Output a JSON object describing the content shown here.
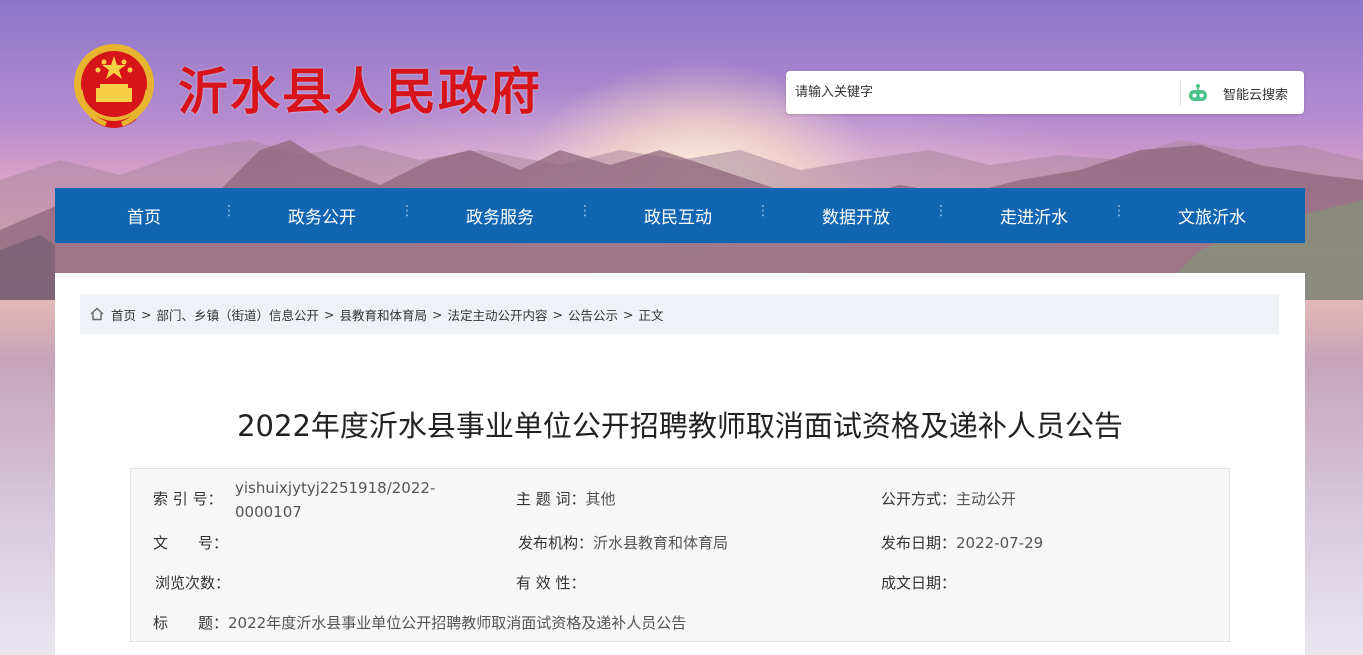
{
  "header": {
    "site_title": "沂水县人民政府",
    "emblem": "national-emblem-icon",
    "search": {
      "placeholder": "请输入关键字",
      "button_label": "智能云搜索",
      "button_icon": "robot-icon"
    }
  },
  "nav": {
    "items": [
      "首页",
      "政务公开",
      "政务服务",
      "政民互动",
      "数据开放",
      "走进沂水",
      "文旅沂水"
    ],
    "separator": "⋮"
  },
  "breadcrumb": {
    "icon": "home-icon",
    "items": [
      "首页",
      "部门、乡镇（街道）信息公开",
      "县教育和体育局",
      "法定主动公开内容",
      "公告公示",
      "正文"
    ],
    "separator": ">"
  },
  "article": {
    "title": "2022年度沂水县事业单位公开招聘教师取消面试资格及递补人员公告"
  },
  "meta": {
    "index_no_label": "索 引 号：",
    "index_no_line1": "yishuixjytyj2251918/2022-",
    "index_no_line2": "0000107",
    "keyword_label": "主 题 词：",
    "keyword": "其他",
    "open_mode_label": "公开方式：",
    "open_mode": "主动公开",
    "doc_no_label": "文　　号：",
    "doc_no": "",
    "publisher_label": "发布机构：",
    "publisher": "沂水县教育和体育局",
    "pub_date_label": "发布日期：",
    "pub_date": "2022-07-29",
    "views_label": "浏览次数：",
    "views": "",
    "validity_label": "有 效 性：",
    "validity": "",
    "doc_date_label": "成文日期：",
    "doc_date": "",
    "title_label": "标　　题：",
    "title": "2022年度沂水县事业单位公开招聘教师取消面试资格及递补人员公告"
  },
  "colors": {
    "title_red": "#d8141b",
    "nav_blue": "#1266b1",
    "breadcrumb_bg": "#eef2f7"
  }
}
